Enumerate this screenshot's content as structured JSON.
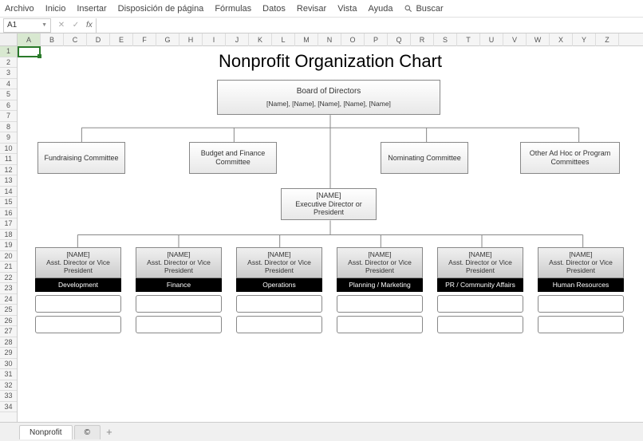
{
  "menu": {
    "items": [
      "Archivo",
      "Inicio",
      "Insertar",
      "Disposición de página",
      "Fórmulas",
      "Datos",
      "Revisar",
      "Vista",
      "Ayuda"
    ],
    "search": "Buscar"
  },
  "namebox": "A1",
  "cols": [
    "A",
    "B",
    "C",
    "D",
    "E",
    "F",
    "G",
    "H",
    "I",
    "J",
    "K",
    "L",
    "M",
    "N",
    "O",
    "P",
    "Q",
    "R",
    "S",
    "T",
    "U",
    "V",
    "W",
    "X",
    "Y",
    "Z"
  ],
  "rows": [
    "1",
    "2",
    "3",
    "4",
    "5",
    "6",
    "7",
    "8",
    "9",
    "10",
    "11",
    "12",
    "13",
    "14",
    "15",
    "16",
    "17",
    "18",
    "19",
    "20",
    "21",
    "22",
    "23",
    "24",
    "25",
    "26",
    "27",
    "28",
    "29",
    "30",
    "31",
    "32",
    "33",
    "34"
  ],
  "chart": {
    "title": "Nonprofit Organization Chart",
    "board": {
      "title": "Board of Directors",
      "sub": "[Name], [Name], [Name], [Name], [Name]"
    },
    "committees": [
      "Fundraising Committee",
      "Budget and Finance Committee",
      "Nominating Committee",
      "Other Ad Hoc or Program Committees"
    ],
    "exec": {
      "name": "[NAME]",
      "role": "Executive Director or President"
    },
    "depts": [
      {
        "name": "[NAME]",
        "role": "Asst. Director or Vice President",
        "label": "Development"
      },
      {
        "name": "[NAME]",
        "role": "Asst. Director or Vice President",
        "label": "Finance"
      },
      {
        "name": "[NAME]",
        "role": "Asst. Director or Vice President",
        "label": "Operations"
      },
      {
        "name": "[NAME]",
        "role": "Asst. Director or Vice President",
        "label": "Planning / Marketing"
      },
      {
        "name": "[NAME]",
        "role": "Asst. Director or Vice President",
        "label": "PR / Community Affairs"
      },
      {
        "name": "[NAME]",
        "role": "Asst. Director or Vice President",
        "label": "Human Resources"
      }
    ]
  },
  "tabs": {
    "active": "Nonprofit",
    "other": "©"
  }
}
